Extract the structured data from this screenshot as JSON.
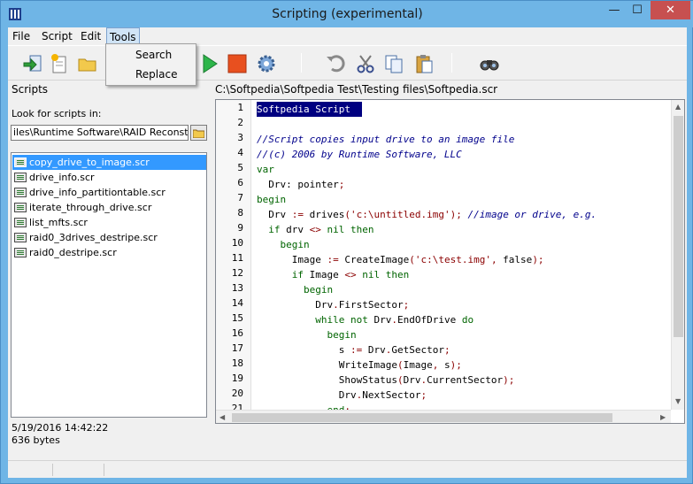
{
  "window": {
    "title": "Scripting (experimental)",
    "min_glyph": "—",
    "max_glyph": "☐",
    "close_glyph": "✕"
  },
  "menu": {
    "file": "File",
    "script": "Script",
    "edit": "Edit",
    "tools": "Tools"
  },
  "tools_menu": {
    "items": [
      "Search",
      "Replace"
    ]
  },
  "toolbar": {
    "buttons": [
      "import-icon",
      "new-script-icon",
      "open-folder-icon",
      "run-icon",
      "stop-icon",
      "settings-gear-icon",
      "undo-icon",
      "cut-icon",
      "copy-icon",
      "paste-icon",
      "binoculars-icon"
    ]
  },
  "scripts_panel": {
    "header": "Scripts",
    "look_label": "Look for scripts in:",
    "path_value": "iles\\Runtime Software\\RAID Reconstruct",
    "files": [
      "copy_drive_to_image.scr",
      "drive_info.scr",
      "drive_info_partitiontable.scr",
      "iterate_through_drive.scr",
      "list_mfts.scr",
      "raid0_3drives_destripe.scr",
      "raid0_destripe.scr"
    ],
    "selected_index": 0,
    "date": "5/19/2016 14:42:22",
    "size": "636 bytes"
  },
  "editor": {
    "path": "C:\\Softpedia\\Softpedia Test\\Testing files\\Softpedia.scr",
    "line_numbers": [
      "1",
      "2",
      "3",
      "4",
      "5",
      "6",
      "7",
      "8",
      "9",
      "10",
      "11",
      "12",
      "13",
      "14",
      "15",
      "16",
      "17",
      "18",
      "19",
      "20",
      "21"
    ],
    "lines": [
      [
        {
          "t": "Softpedia Script ",
          "c": "pl"
        }
      ],
      [],
      [
        {
          "t": "//Script copies input drive to an image file",
          "c": "cm"
        }
      ],
      [
        {
          "t": "//(c) 2006 by Runtime Software, LLC",
          "c": "cm"
        }
      ],
      [
        {
          "t": "var",
          "c": "kw"
        }
      ],
      [
        {
          "t": "  Drv: pointer",
          "c": "pl"
        },
        {
          "t": ";",
          "c": "op"
        }
      ],
      [
        {
          "t": "begin",
          "c": "kw"
        }
      ],
      [
        {
          "t": "  Drv ",
          "c": "pl"
        },
        {
          "t": ":=",
          "c": "op"
        },
        {
          "t": " drives",
          "c": "pl"
        },
        {
          "t": "(",
          "c": "op"
        },
        {
          "t": "'c:\\untitled.img'",
          "c": "str"
        },
        {
          "t": "); ",
          "c": "op"
        },
        {
          "t": "//image or drive, e.g.",
          "c": "cm"
        }
      ],
      [
        {
          "t": "  ",
          "c": "pl"
        },
        {
          "t": "if",
          "c": "kw"
        },
        {
          "t": " drv ",
          "c": "pl"
        },
        {
          "t": "<>",
          "c": "op"
        },
        {
          "t": " nil ",
          "c": "kw"
        },
        {
          "t": "then",
          "c": "kw"
        }
      ],
      [
        {
          "t": "    ",
          "c": "pl"
        },
        {
          "t": "begin",
          "c": "kw"
        }
      ],
      [
        {
          "t": "      Image ",
          "c": "pl"
        },
        {
          "t": ":=",
          "c": "op"
        },
        {
          "t": " CreateImage",
          "c": "pl"
        },
        {
          "t": "(",
          "c": "op"
        },
        {
          "t": "'c:\\test.img'",
          "c": "str"
        },
        {
          "t": ",",
          "c": "op"
        },
        {
          "t": " false",
          "c": "pl"
        },
        {
          "t": ");",
          "c": "op"
        }
      ],
      [
        {
          "t": "      ",
          "c": "pl"
        },
        {
          "t": "if",
          "c": "kw"
        },
        {
          "t": " Image ",
          "c": "pl"
        },
        {
          "t": "<>",
          "c": "op"
        },
        {
          "t": " nil ",
          "c": "kw"
        },
        {
          "t": "then",
          "c": "kw"
        }
      ],
      [
        {
          "t": "        ",
          "c": "pl"
        },
        {
          "t": "begin",
          "c": "kw"
        }
      ],
      [
        {
          "t": "          Drv",
          "c": "pl"
        },
        {
          "t": ".",
          "c": "op"
        },
        {
          "t": "FirstSector",
          "c": "pl"
        },
        {
          "t": ";",
          "c": "op"
        }
      ],
      [
        {
          "t": "          ",
          "c": "pl"
        },
        {
          "t": "while not",
          "c": "kw"
        },
        {
          "t": " Drv",
          "c": "pl"
        },
        {
          "t": ".",
          "c": "op"
        },
        {
          "t": "EndOfDrive ",
          "c": "pl"
        },
        {
          "t": "do",
          "c": "kw"
        }
      ],
      [
        {
          "t": "            ",
          "c": "pl"
        },
        {
          "t": "begin",
          "c": "kw"
        }
      ],
      [
        {
          "t": "              s ",
          "c": "pl"
        },
        {
          "t": ":=",
          "c": "op"
        },
        {
          "t": " Drv",
          "c": "pl"
        },
        {
          "t": ".",
          "c": "op"
        },
        {
          "t": "GetSector",
          "c": "pl"
        },
        {
          "t": ";",
          "c": "op"
        }
      ],
      [
        {
          "t": "              WriteImage",
          "c": "pl"
        },
        {
          "t": "(",
          "c": "op"
        },
        {
          "t": "Image",
          "c": "pl"
        },
        {
          "t": ",",
          "c": "op"
        },
        {
          "t": " s",
          "c": "pl"
        },
        {
          "t": ");",
          "c": "op"
        }
      ],
      [
        {
          "t": "              ShowStatus",
          "c": "pl"
        },
        {
          "t": "(",
          "c": "op"
        },
        {
          "t": "Drv",
          "c": "pl"
        },
        {
          "t": ".",
          "c": "op"
        },
        {
          "t": "CurrentSector",
          "c": "pl"
        },
        {
          "t": ");",
          "c": "op"
        }
      ],
      [
        {
          "t": "              Drv",
          "c": "pl"
        },
        {
          "t": ".",
          "c": "op"
        },
        {
          "t": "NextSector",
          "c": "pl"
        },
        {
          "t": ";",
          "c": "op"
        }
      ],
      [
        {
          "t": "            end",
          "c": "kw"
        },
        {
          "t": ";",
          "c": "op"
        }
      ]
    ],
    "highlight_line": 0
  }
}
